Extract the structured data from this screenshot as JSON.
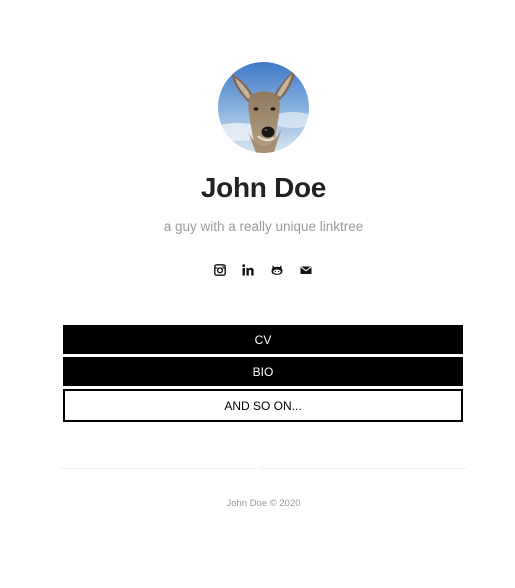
{
  "profile": {
    "name": "John Doe",
    "tagline": "a guy with a really unique linktree",
    "avatar_alt": "deer portrait"
  },
  "socials": [
    {
      "icon": "instagram-icon"
    },
    {
      "icon": "linkedin-icon"
    },
    {
      "icon": "github-icon"
    },
    {
      "icon": "mail-icon"
    }
  ],
  "links": [
    {
      "label": "CV",
      "style": "solid"
    },
    {
      "label": "BIO",
      "style": "solid"
    },
    {
      "label": "AND SO ON...",
      "style": "outline"
    }
  ],
  "footer": {
    "text": "John Doe © 2020"
  },
  "colors": {
    "text": "#222222",
    "muted": "#9a9a9a",
    "button": "#000000",
    "background": "#ffffff"
  }
}
